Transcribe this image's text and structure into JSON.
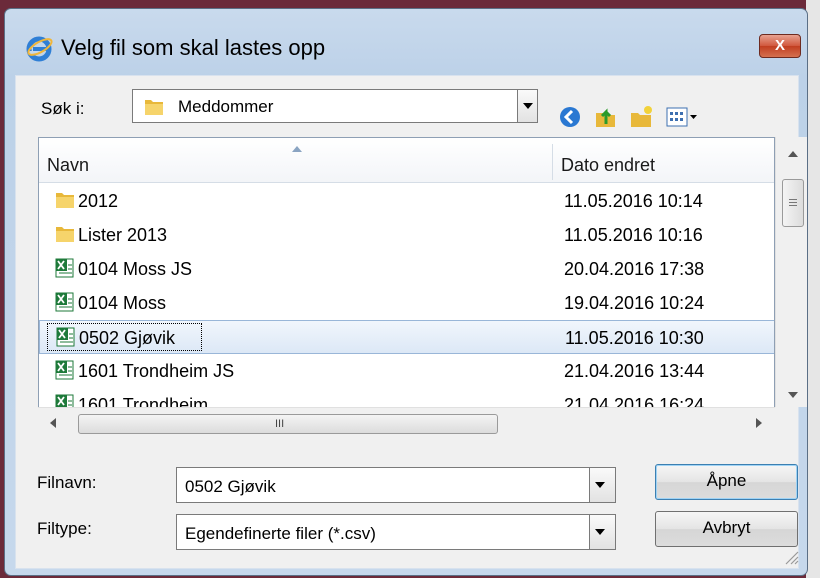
{
  "window": {
    "title": "Velg fil som skal lastes opp",
    "close_symbol": "X"
  },
  "lookin": {
    "label": "Søk i:",
    "value": "Meddommer"
  },
  "columns": {
    "name": "Navn",
    "date": "Dato endret"
  },
  "files": [
    {
      "name": "2012",
      "date": "11.05.2016 10:14",
      "icon": "folder-icon"
    },
    {
      "name": "Lister 2013",
      "date": "11.05.2016 10:16",
      "icon": "folder-icon"
    },
    {
      "name": "0104 Moss JS",
      "date": "20.04.2016 17:38",
      "icon": "excel-file-icon"
    },
    {
      "name": "0104 Moss",
      "date": "19.04.2016 10:24",
      "icon": "excel-file-icon"
    },
    {
      "name": "0502 Gjøvik",
      "date": "11.05.2016 10:30",
      "icon": "excel-file-icon",
      "selected": true
    },
    {
      "name": "1601 Trondheim JS",
      "date": "21.04.2016 13:44",
      "icon": "excel-file-icon"
    },
    {
      "name": "1601 Trondheim",
      "date": "21.04.2016 16:24",
      "icon": "excel-file-icon"
    }
  ],
  "hscroll_grip": "III",
  "filename": {
    "label": "Filnavn:",
    "value": "0502 Gjøvik"
  },
  "filetype": {
    "label": "Filtype:",
    "value": "Egendefinerte filer (*.csv)"
  },
  "buttons": {
    "open": "Åpne",
    "cancel": "Avbryt"
  },
  "colors": {
    "selection": "#dce8f6",
    "titlebar": "#c6d8ec",
    "close": "#c94a2c"
  }
}
